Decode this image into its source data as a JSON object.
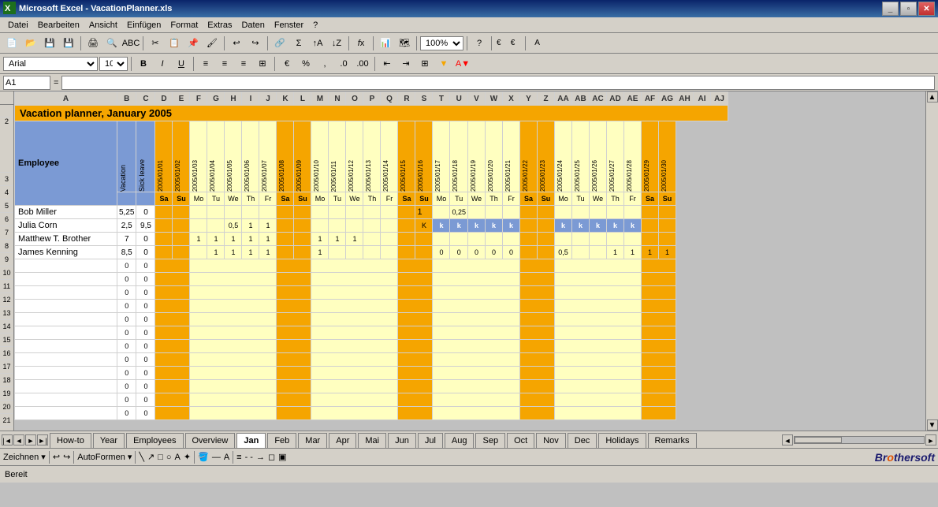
{
  "titleBar": {
    "icon": "excel-icon",
    "title": "Microsoft Excel - VacationPlanner.xls",
    "buttons": [
      "minimize",
      "restore",
      "close"
    ]
  },
  "menuBar": {
    "items": [
      "Datei",
      "Bearbeiten",
      "Ansicht",
      "Einfügen",
      "Format",
      "Extras",
      "Daten",
      "Fenster",
      "?"
    ]
  },
  "formulaBar": {
    "cellRef": "A1",
    "formula": ""
  },
  "spreadsheet": {
    "title": "Vacation planner, January 2005",
    "headers": {
      "employee": "Employee",
      "vacation": "Vacation",
      "sickLeave": "Sick leave"
    },
    "employees": [
      {
        "name": "Bob Miller",
        "vacation": "5,25",
        "sick": "0"
      },
      {
        "name": "Julia Corn",
        "vacation": "2,5",
        "sick": "9,5"
      },
      {
        "name": "Matthew T. Brother",
        "vacation": "7",
        "sick": "0"
      },
      {
        "name": "James Kenning",
        "vacation": "8,5",
        "sick": "0"
      }
    ],
    "months": [
      "Jan",
      "Feb",
      "Mar",
      "Apr",
      "Mai",
      "Jun",
      "Jul",
      "Aug",
      "Sep",
      "Oct",
      "Nov",
      "Dec"
    ],
    "tabs": [
      "How-to",
      "Year",
      "Employees",
      "Overview",
      "Jan",
      "Feb",
      "Mar",
      "Apr",
      "Mai",
      "Jun",
      "Jul",
      "Aug",
      "Sep",
      "Oct",
      "Nov",
      "Dec",
      "Holidays",
      "Remarks"
    ],
    "activeTab": "Jan",
    "statusBar": "Bereit",
    "zoom": "100%",
    "font": "Arial",
    "fontSize": "10"
  }
}
